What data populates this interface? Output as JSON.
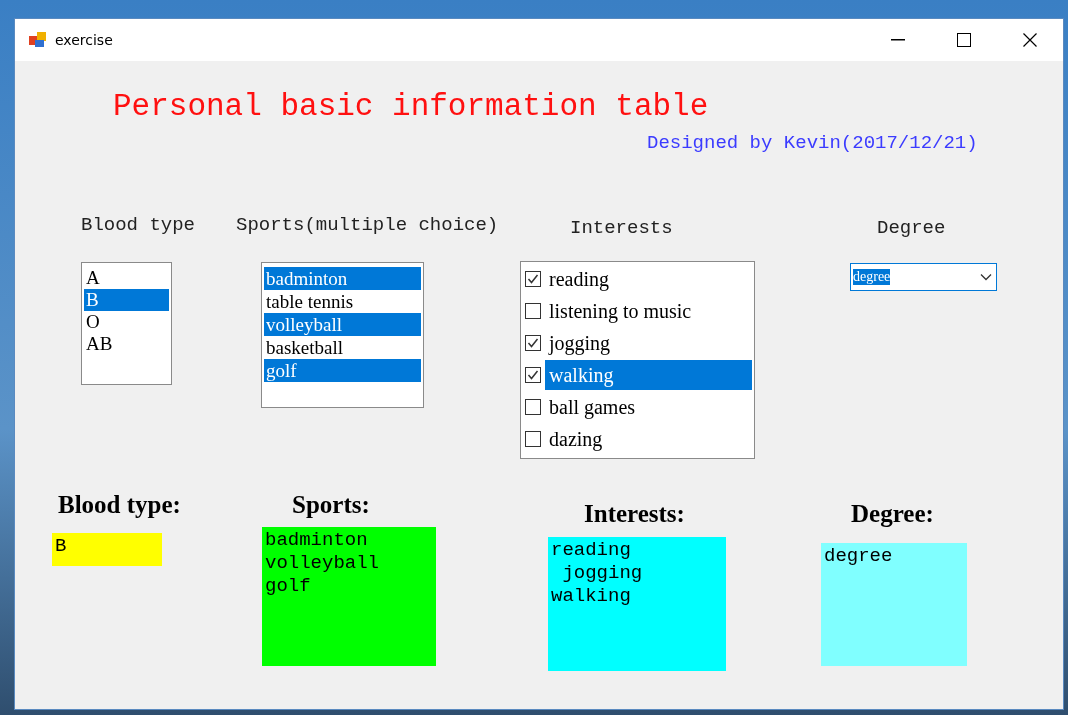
{
  "window": {
    "title": "exercise"
  },
  "heading": "Personal basic information table",
  "credit": "Designed by Kevin(2017/12/21)",
  "blood_type": {
    "label": "Blood type",
    "items": [
      {
        "label": "A",
        "selected": false
      },
      {
        "label": "B",
        "selected": true
      },
      {
        "label": "O",
        "selected": false
      },
      {
        "label": "AB",
        "selected": false
      }
    ]
  },
  "sports": {
    "label": "Sports(multiple choice)",
    "items": [
      {
        "label": "badminton",
        "selected": true
      },
      {
        "label": "table tennis",
        "selected": false
      },
      {
        "label": "volleyball",
        "selected": true
      },
      {
        "label": "basketball",
        "selected": false
      },
      {
        "label": "golf",
        "selected": true
      }
    ]
  },
  "interests": {
    "label": "Interests",
    "items": [
      {
        "label": "reading",
        "checked": true,
        "selected": false
      },
      {
        "label": "listening to music",
        "checked": false,
        "selected": false
      },
      {
        "label": "jogging",
        "checked": true,
        "selected": false
      },
      {
        "label": "walking",
        "checked": true,
        "selected": true
      },
      {
        "label": "ball games",
        "checked": false,
        "selected": false
      },
      {
        "label": "dazing",
        "checked": false,
        "selected": false
      }
    ]
  },
  "degree": {
    "label": "Degree",
    "value": "degree"
  },
  "results": [
    {
      "label": "Blood type:",
      "lines": [
        "B"
      ],
      "color": "#ffff00"
    },
    {
      "label": "Sports:",
      "lines": [
        "badminton",
        "volleyball",
        "golf"
      ],
      "color": "#00ff00"
    },
    {
      "label": "Interests:",
      "lines": [
        "reading",
        " jogging",
        "walking"
      ],
      "color": "#00ffff"
    },
    {
      "label": "Degree:",
      "lines": [
        "degree"
      ],
      "color": "#80ffff"
    }
  ]
}
